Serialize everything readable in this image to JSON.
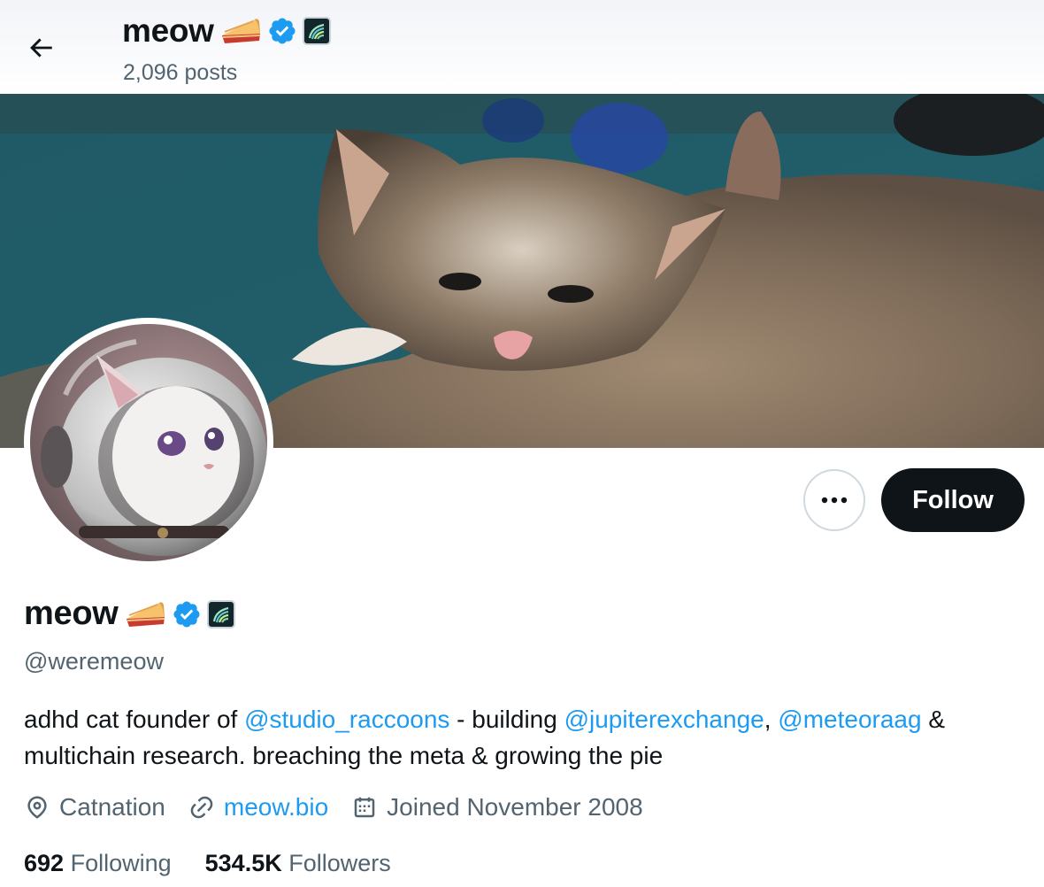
{
  "header": {
    "display_name": "meow",
    "post_count": "2,096 posts"
  },
  "profile": {
    "display_name": "meow",
    "handle": "@weremeow",
    "bio": {
      "part1": "adhd cat founder of ",
      "mention1": "@studio_raccoons",
      "part2": " - building ",
      "mention2": "@jupiterexchange",
      "part3": ", ",
      "mention3": "@meteoraag",
      "part4": " & multichain research. breaching the meta & growing the pie"
    },
    "location": "Catnation",
    "website": "meow.bio",
    "joined": "Joined November 2008",
    "following_count": "692",
    "following_label": "Following",
    "followers_count": "534.5K",
    "followers_label": "Followers"
  },
  "actions": {
    "more_label": "•••",
    "follow_label": "Follow"
  },
  "icons": {
    "back": "arrow-left-icon",
    "pie": "pie-emoji-icon",
    "verified": "verified-badge-icon",
    "affiliate": "affiliate-badge-icon",
    "location": "location-pin-icon",
    "link": "link-icon",
    "calendar": "calendar-icon"
  },
  "colors": {
    "accent": "#1d9bf0",
    "text": "#0f1419",
    "secondary": "#536471",
    "follow_bg": "#0f1419"
  }
}
